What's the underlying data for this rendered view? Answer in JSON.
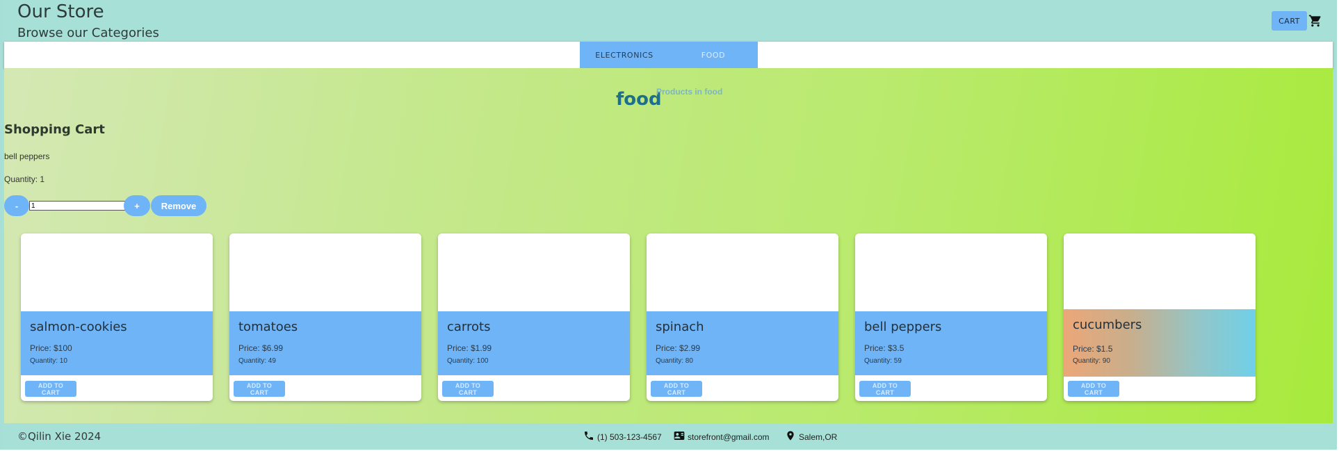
{
  "header": {
    "title": "Our Store",
    "subtitle": "Browse our Categories",
    "cart_label": "CART"
  },
  "tabs": [
    {
      "label": "ELECTRONICS"
    },
    {
      "label": "FOOD"
    }
  ],
  "category": {
    "title": "food",
    "subtitle": "Products in food"
  },
  "cart": {
    "heading": "Shopping Cart",
    "item_name": "bell peppers",
    "item_quantity": "Quantity: 1",
    "quantity_value": "1",
    "minus_label": "-",
    "plus_label": "+",
    "remove_label": "Remove"
  },
  "products": [
    {
      "name": "salmon-cookies",
      "price": "Price: $100",
      "quantity": "Quantity: 10",
      "button": "ADD TO CART"
    },
    {
      "name": "tomatoes",
      "price": "Price: $6.99",
      "quantity": "Quantity: 49",
      "button": "ADD TO CART"
    },
    {
      "name": "carrots",
      "price": "Price: $1.99",
      "quantity": "Quantity: 100",
      "button": "ADD TO CART"
    },
    {
      "name": "spinach",
      "price": "Price: $2.99",
      "quantity": "Quantity: 80",
      "button": "ADD TO CART"
    },
    {
      "name": "bell peppers",
      "price": "Price: $3.5",
      "quantity": "Quantity: 59",
      "button": "ADD TO CART"
    },
    {
      "name": "cucumbers",
      "price": "Price: $1.5",
      "quantity": "Quantity: 90",
      "button": "ADD TO CART"
    }
  ],
  "footer": {
    "copyright": "©Qilin Xie 2024",
    "phone": "(1) 503-123-4567",
    "email": "storefront@gmail.com",
    "location": "Salem,OR"
  },
  "icons": {
    "cart": "shopping-cart-icon",
    "phone": "phone-icon",
    "email": "contact-card-icon",
    "location": "location-pin-icon"
  },
  "colors": {
    "header_bg": "#a7e0d6",
    "accent_blue": "#6fb4f7",
    "category_title": "#1d6f8c"
  }
}
